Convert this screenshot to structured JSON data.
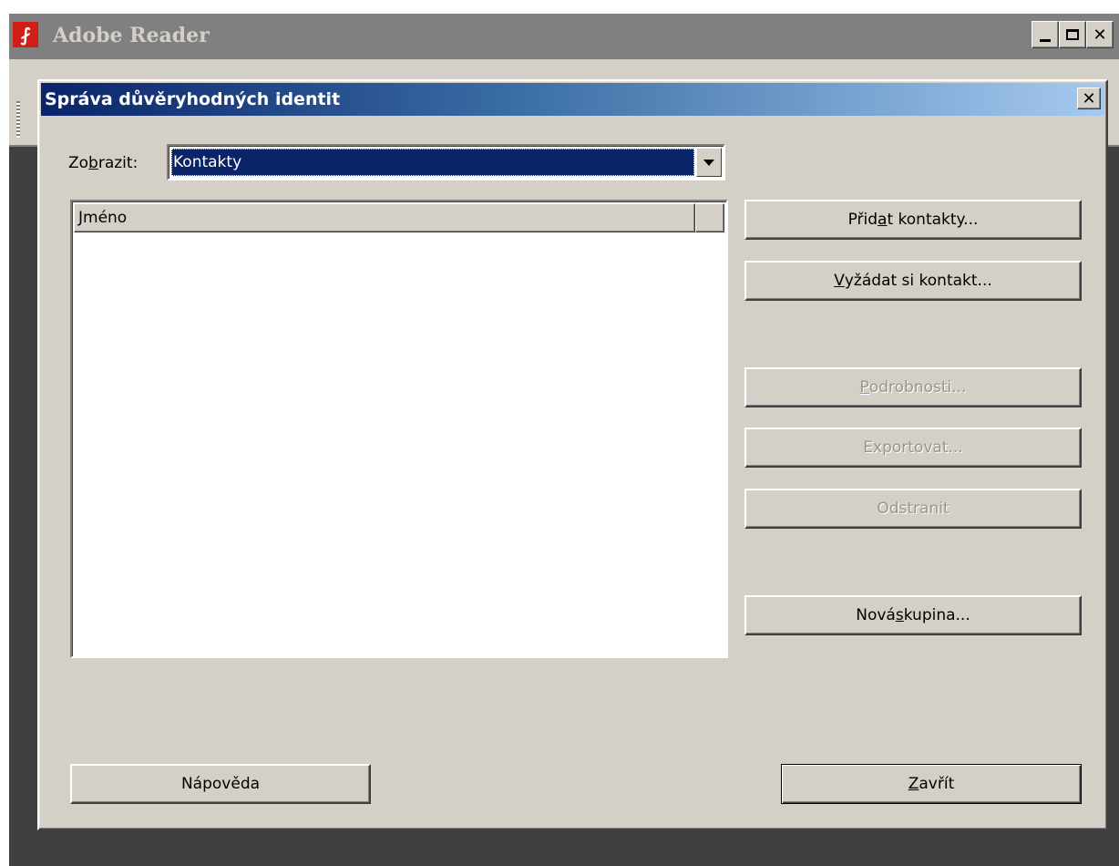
{
  "app": {
    "title": "Adobe Reader",
    "logo_icon": "adobe-reader-logo",
    "logo_glyph": "⨏",
    "controls": {
      "minimize_icon": "minimize-icon",
      "maximize_icon": "maximize-icon",
      "close_icon": "close-icon",
      "close_glyph": "✕"
    }
  },
  "dialog": {
    "title": "Správa důvěryhodných identit",
    "close_glyph": "✕",
    "show": {
      "label_before": "Zo",
      "label_accel": "b",
      "label_after": "razit:",
      "selected": "Kontakty"
    },
    "list": {
      "columns": [
        "Jméno",
        ""
      ],
      "rows": []
    },
    "buttons": {
      "add_contacts": {
        "before": "Přid",
        "accel": "a",
        "after": "t kontakty...",
        "enabled": true
      },
      "request_contact": {
        "before": "",
        "accel": "V",
        "after": "yžádat si kontakt...",
        "enabled": true
      },
      "details": {
        "before": "",
        "accel": "P",
        "after": "odrobnosti...",
        "enabled": false
      },
      "export": {
        "before": "Exportovat...",
        "accel": "",
        "after": "",
        "enabled": false
      },
      "remove": {
        "before": "Odstranit",
        "accel": "",
        "after": "",
        "enabled": false
      },
      "new_group": {
        "before": "Nová ",
        "accel": "s",
        "after": "kupina...",
        "enabled": true
      },
      "help": {
        "label": "Nápověda"
      },
      "close": {
        "before": "",
        "accel": "Z",
        "after": "avřít"
      }
    }
  },
  "colors": {
    "dialog_title_start": "#0a246a",
    "dialog_title_end": "#a6caf0",
    "app_title_inactive": "#808080",
    "face": "#d4d0c8",
    "selection": "#0a246a"
  }
}
